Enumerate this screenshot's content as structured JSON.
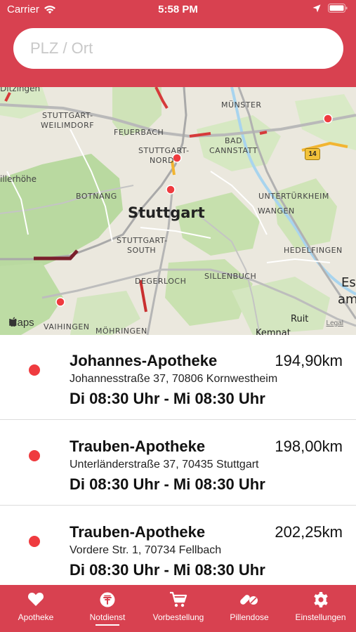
{
  "status_bar": {
    "carrier": "Carrier",
    "time": "5:58 PM"
  },
  "search": {
    "placeholder": "PLZ / Ort",
    "value": ""
  },
  "map": {
    "city": "Stuttgart",
    "labels": {
      "ditzingen": "Ditzingen",
      "weilimdorf_1": "STUTTGART-",
      "weilimdorf_2": "WEILIMDORF",
      "feuerbach": "FEUERBACH",
      "nord_1": "STUTTGART-",
      "nord_2": "NORD",
      "muenster": "MÜNSTER",
      "cannstatt_1": "BAD",
      "cannstatt_2": "CANNSTATT",
      "hillerhoehe": "illerhöhe",
      "botnang": "BOTNANG",
      "untertuerkheim": "UNTERTÜRKHEIM",
      "wangen": "WANGEN",
      "sued_1": "STUTTGART-",
      "sued_2": "SOUTH",
      "hedelfingen": "HEDELFINGEN",
      "sillenbuch": "SILLENBUCH",
      "degerloch": "DEGERLOCH",
      "es_1": "Es",
      "es_2": "am",
      "ruit": "Ruit",
      "vaihingen": "VAIHINGEN",
      "moehringen": "MÖHRINGEN",
      "kemnat": "Kemnat"
    },
    "road_shield": "14",
    "brand": "Maps",
    "legal": "Legal"
  },
  "pharmacies": [
    {
      "name": "Johannes-Apotheke",
      "distance": "194,90km",
      "address": "Johannesstraße 37, 70806 Kornwestheim",
      "hours": "Di 08:30 Uhr - Mi 08:30 Uhr"
    },
    {
      "name": "Trauben-Apotheke",
      "distance": "198,00km",
      "address": "Unterländerstraße 37, 70435 Stuttgart",
      "hours": "Di 08:30 Uhr - Mi 08:30 Uhr"
    },
    {
      "name": "Trauben-Apotheke",
      "distance": "202,25km",
      "address": "Vordere Str. 1, 70734 Fellbach",
      "hours": "Di 08:30 Uhr - Mi 08:30 Uhr"
    }
  ],
  "tabs": [
    {
      "label": "Apotheke",
      "icon": "heart-icon"
    },
    {
      "label": "Notdienst",
      "icon": "emergency-pharmacy-icon",
      "active": true
    },
    {
      "label": "Vorbestellung",
      "icon": "cart-icon"
    },
    {
      "label": "Pillendose",
      "icon": "pills-icon"
    },
    {
      "label": "Einstellungen",
      "icon": "gear-icon"
    }
  ],
  "colors": {
    "brand": "#d84150",
    "marker": "#ef3b3f"
  }
}
